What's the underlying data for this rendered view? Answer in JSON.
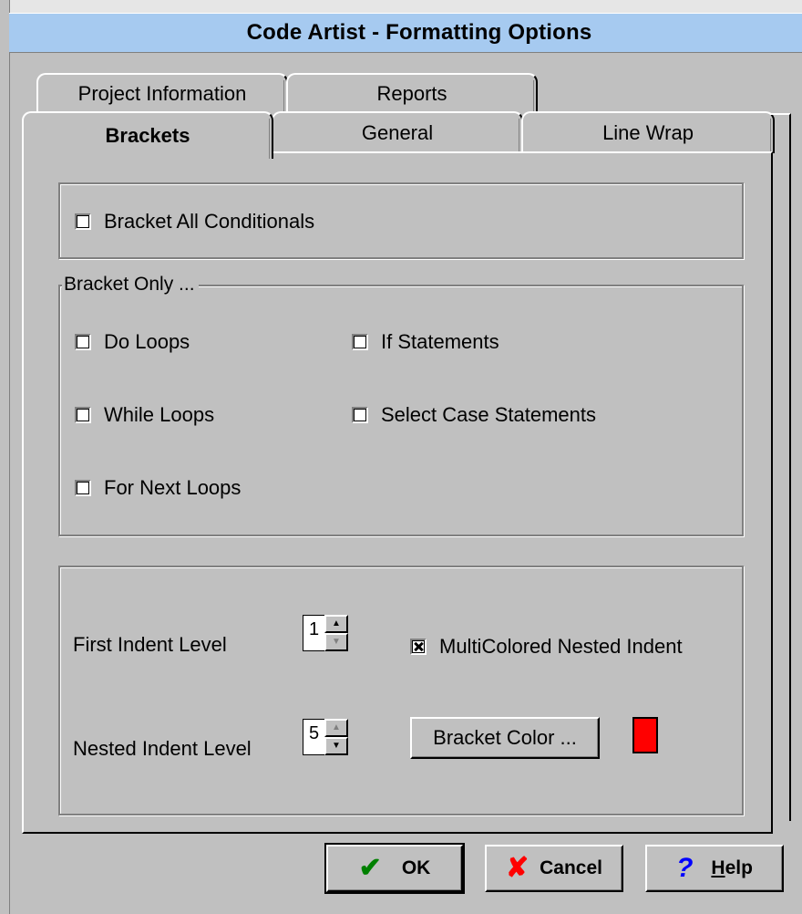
{
  "window": {
    "title": "Code Artist - Formatting Options"
  },
  "tabs": {
    "row_back": [
      {
        "label": "Project Information"
      },
      {
        "label": "Reports"
      }
    ],
    "row_front": [
      {
        "label": "Brackets",
        "active": true
      },
      {
        "label": "General",
        "active": false
      },
      {
        "label": "Line Wrap",
        "active": false
      }
    ]
  },
  "brackets": {
    "bracket_all": {
      "label": "Bracket All Conditionals",
      "checked": false
    },
    "bracket_only": {
      "legend": "Bracket Only ...",
      "do_loops": {
        "label": "Do Loops",
        "checked": false
      },
      "while_loops": {
        "label": "While Loops",
        "checked": false
      },
      "for_next_loops": {
        "label": "For Next Loops",
        "checked": false
      },
      "if_statements": {
        "label": "If Statements",
        "checked": false
      },
      "select_case": {
        "label": "Select Case Statements",
        "checked": false
      }
    },
    "indent": {
      "first_label": "First Indent Level",
      "first_value": "1",
      "nested_label": "Nested Indent Level",
      "nested_value": "5",
      "multicolored": {
        "label": "MultiColored Nested Indent",
        "checked": true
      },
      "bracket_color_label": "Bracket Color ...",
      "bracket_color": "#ff0000"
    }
  },
  "footer": {
    "ok": {
      "label": "OK",
      "icon": "check-icon",
      "color": "#008000"
    },
    "cancel": {
      "label": "Cancel",
      "icon": "x-icon",
      "color": "#ff0000"
    },
    "help": {
      "label": "Help",
      "icon": "question-icon",
      "color": "#0000ff"
    }
  }
}
